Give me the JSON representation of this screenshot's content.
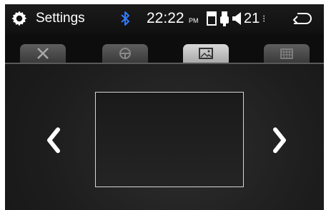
{
  "status_bar": {
    "title": "Settings",
    "time": "22:22",
    "ampm": "PM",
    "volume": "21",
    "volume_more": "⁝",
    "icons": [
      "gear-icon",
      "bluetooth-icon",
      "sd-card-icon",
      "usb-icon",
      "speaker-icon",
      "back-icon"
    ]
  },
  "tabs": [
    {
      "icon": "tools-icon",
      "active": false
    },
    {
      "icon": "steering-wheel-icon",
      "active": false
    },
    {
      "icon": "picture-icon",
      "active": true
    },
    {
      "icon": "calendar-icon",
      "active": false
    }
  ],
  "content": {
    "prev_icon": "chevron-left-icon",
    "next_icon": "chevron-right-icon"
  },
  "colors": {
    "accent_bluetooth": "#2f7bff",
    "background": "#1d1d1d",
    "active_tab": "#c8c8c8",
    "inactive_tab": "#4a4a4a"
  }
}
